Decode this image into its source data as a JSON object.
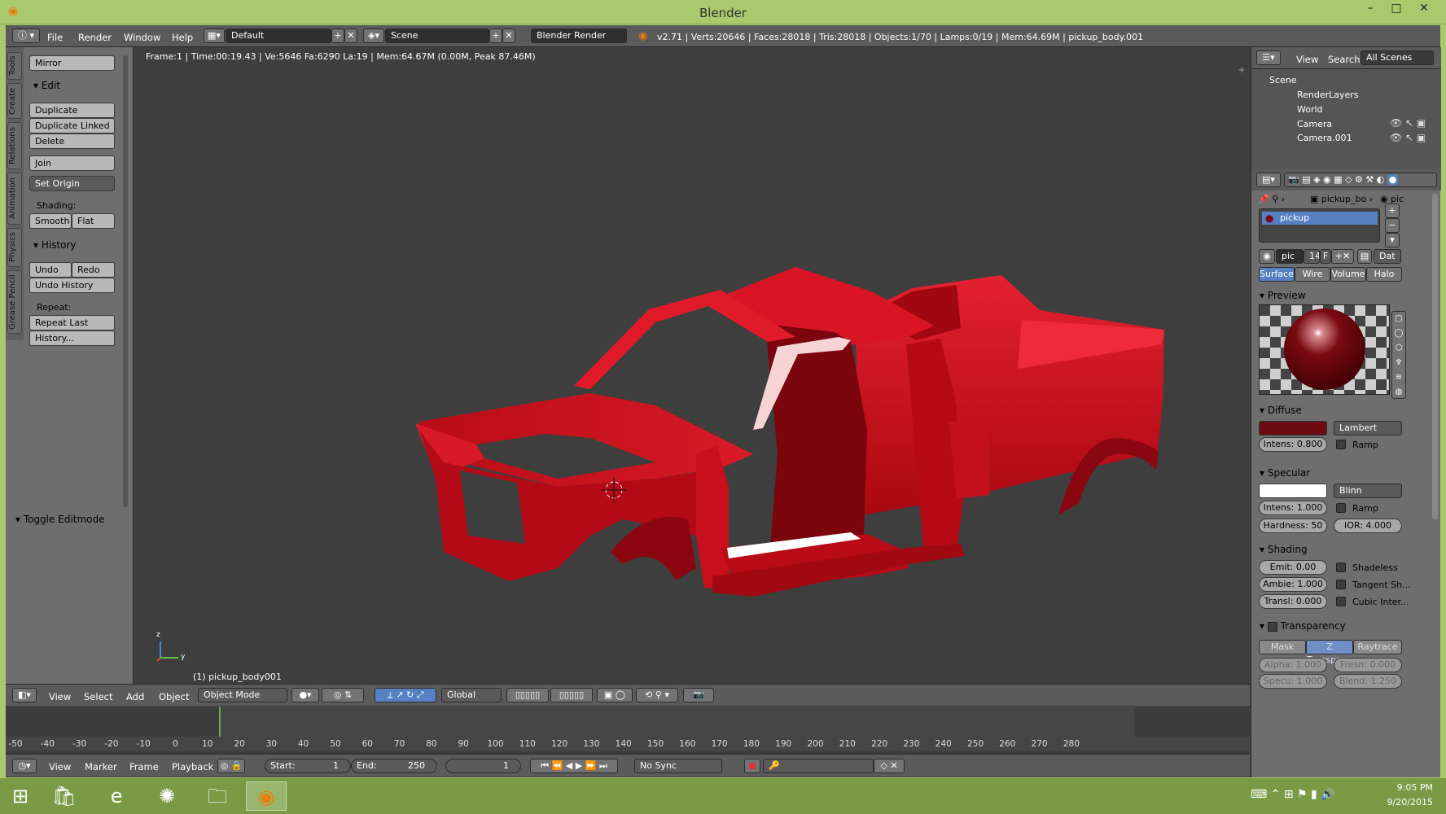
{
  "window": {
    "title": "Blender",
    "minimize": "–",
    "maximize": "□",
    "close": "✕"
  },
  "info_header": {
    "menus": [
      "File",
      "Render",
      "Window",
      "Help"
    ],
    "layout": "Default",
    "scene": "Scene",
    "engine": "Blender Render",
    "stats": "v2.71 | Verts:20646 | Faces:28018 | Tris:28018 | Objects:1/70 | Lamps:0/19 | Mem:64.69M | pickup_body.001"
  },
  "tools_panel": {
    "tabs": [
      "Tools",
      "Create",
      "Relations",
      "Animation",
      "Physics",
      "Grease Pencil"
    ],
    "mirror": "Mirror",
    "edit_header": "Edit",
    "duplicate": "Duplicate",
    "duplicate_linked": "Duplicate Linked",
    "delete": "Delete",
    "join": "Join",
    "set_origin": "Set Origin",
    "shading_label": "Shading:",
    "smooth": "Smooth",
    "flat": "Flat",
    "history_header": "History",
    "undo": "Undo",
    "redo": "Redo",
    "undo_history": "Undo History",
    "repeat_label": "Repeat:",
    "repeat_last": "Repeat Last",
    "history_btn": "History...",
    "toggle_editmode": "Toggle Editmode"
  },
  "viewport": {
    "info": "Frame:1 | Time:00:19.43 | Ve:5646 Fa:6290 La:19 | Mem:64.67M (0.00M, Peak 87.46M)",
    "object_label": "(1) pickup_body001",
    "axis_z": "z",
    "axis_y": "y"
  },
  "viewport_header": {
    "menus": [
      "View",
      "Select",
      "Add",
      "Object"
    ],
    "mode": "Object Mode",
    "orientation": "Global"
  },
  "timeline": {
    "ticks": [
      "-50",
      "-40",
      "-30",
      "-20",
      "-10",
      "0",
      "10",
      "20",
      "30",
      "40",
      "50",
      "60",
      "70",
      "80",
      "90",
      "100",
      "110",
      "120",
      "130",
      "140",
      "150",
      "160",
      "170",
      "180",
      "190",
      "200",
      "210",
      "220",
      "230",
      "240",
      "250",
      "260",
      "270",
      "280"
    ],
    "menus": [
      "View",
      "Marker",
      "Frame",
      "Playback"
    ],
    "start_label": "Start:",
    "start_value": "1",
    "end_label": "End:",
    "end_value": "250",
    "current": "1",
    "sync": "No Sync"
  },
  "outliner": {
    "view": "View",
    "search": "Search",
    "filter": "All Scenes",
    "items": [
      "Scene",
      "RenderLayers",
      "World",
      "Camera",
      "Camera.001"
    ]
  },
  "properties": {
    "breadcrumb_object": "pickup_bo",
    "breadcrumb_material": "pic",
    "material_slot": "pickup",
    "mat_name": "pic",
    "mat_users": "14",
    "mat_fake": "F",
    "data_btn": "Dat",
    "tabs": [
      "Surface",
      "Wire",
      "Volume",
      "Halo"
    ],
    "preview_header": "Preview",
    "diffuse_header": "Diffuse",
    "diffuse_color": "#6b0a10",
    "diffuse_shader": "Lambert",
    "diffuse_intens": "Intens: 0.800",
    "ramp": "Ramp",
    "specular_header": "Specular",
    "specular_color": "#ffffff",
    "specular_shader": "Blinn",
    "spec_intens": "Intens: 1.000",
    "hardness": "Hardness: 50",
    "ior": "IOR:   4.000",
    "shading_header": "Shading",
    "emit": "Emit:    0.00",
    "ambient": "Ambie: 1.000",
    "translucency": "Transl:  0.000",
    "shadeless": "Shadeless",
    "tangent": "Tangent Sh...",
    "cubic": "Cubic Inter...",
    "transparency_header": "Transparency",
    "mask": "Mask",
    "ztransp": "Z Transpar...",
    "raytrace": "Raytrace",
    "alpha": "Alpha: 1.000",
    "fresnel": "Fresn: 0.000",
    "specu": "Specu: 1.000",
    "blend": "Blend: 1.250"
  },
  "taskbar": {
    "time": "9:05 PM",
    "date": "9/20/2015"
  },
  "colors": {
    "body_red": "#c8101e",
    "accent_blue": "#5680c2",
    "taskbar": "#7a9a45"
  }
}
